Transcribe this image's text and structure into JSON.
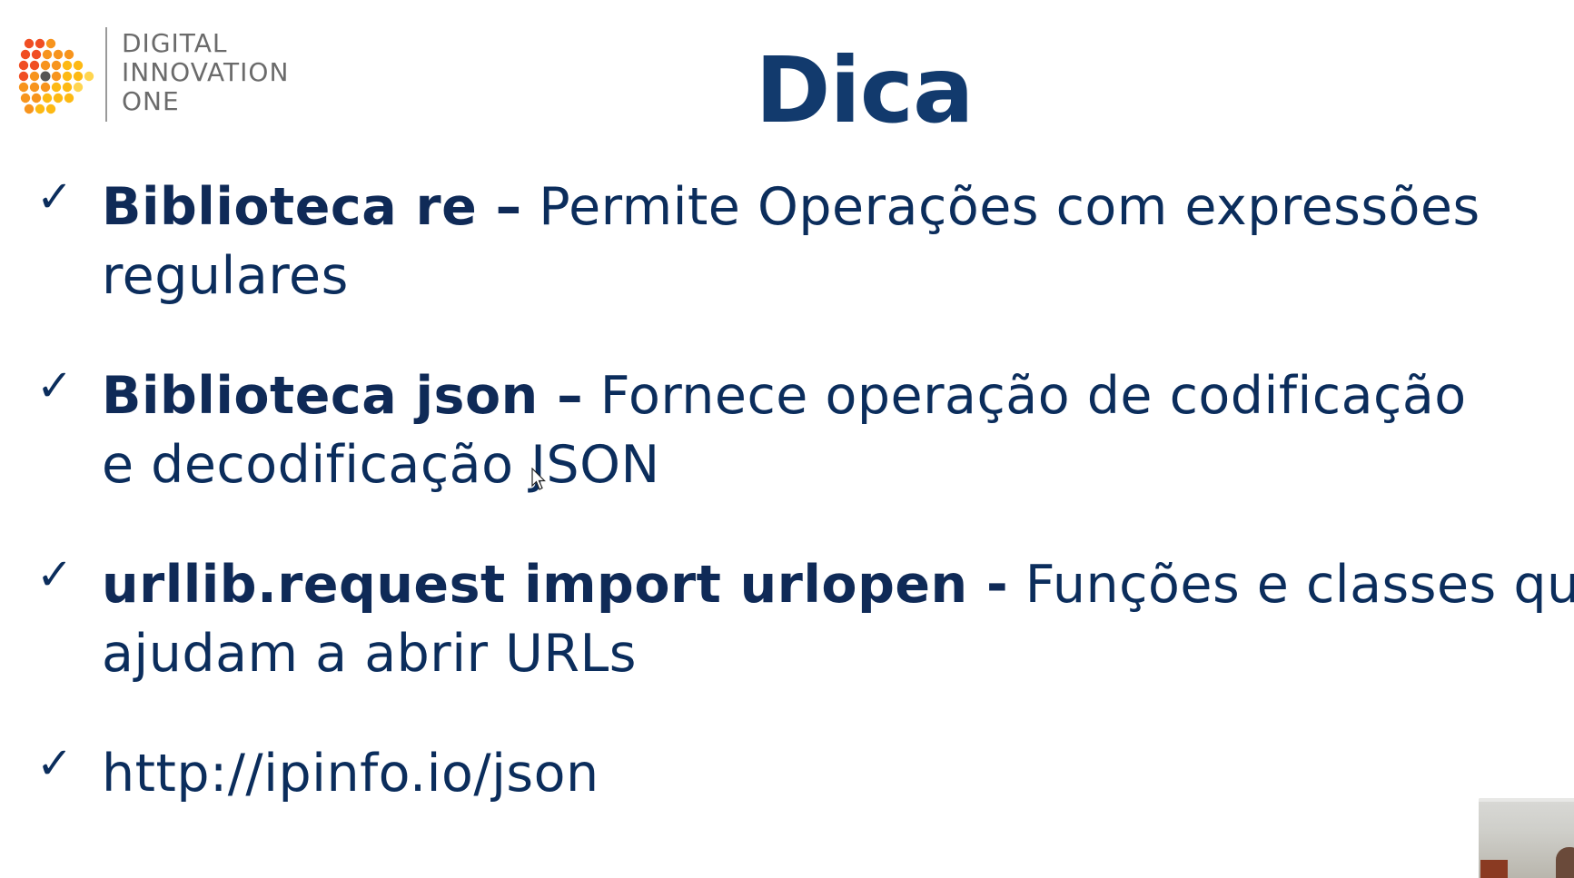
{
  "logo": {
    "lines": [
      "DIGITAL",
      "INNOVATION",
      "ONE"
    ],
    "icon": "dio-dots-play-icon",
    "colors": [
      "#f04e23",
      "#f7941d",
      "#fdb913",
      "#ffd54f"
    ]
  },
  "slide": {
    "title": "Dica",
    "items": [
      {
        "bold": "Biblioteca re –",
        "text_line1": " Permite Operações com expressões",
        "text_line2": "regulares"
      },
      {
        "bold": "Biblioteca json –",
        "text_line1": " Fornece operação de codificação",
        "text_line2": "e decodificação JSON"
      },
      {
        "bold": "urllib.request import urlopen -",
        "text_line1": " Funções e classes que",
        "text_line2": "ajudam a abrir URLs"
      },
      {
        "bold": "",
        "text_line1": "http://ipinfo.io/json",
        "text_line2": ""
      }
    ],
    "check_icon": "checkmark-icon",
    "text_color": "#0b2d5c"
  },
  "webcam": {
    "icon": "webcam-feed"
  }
}
